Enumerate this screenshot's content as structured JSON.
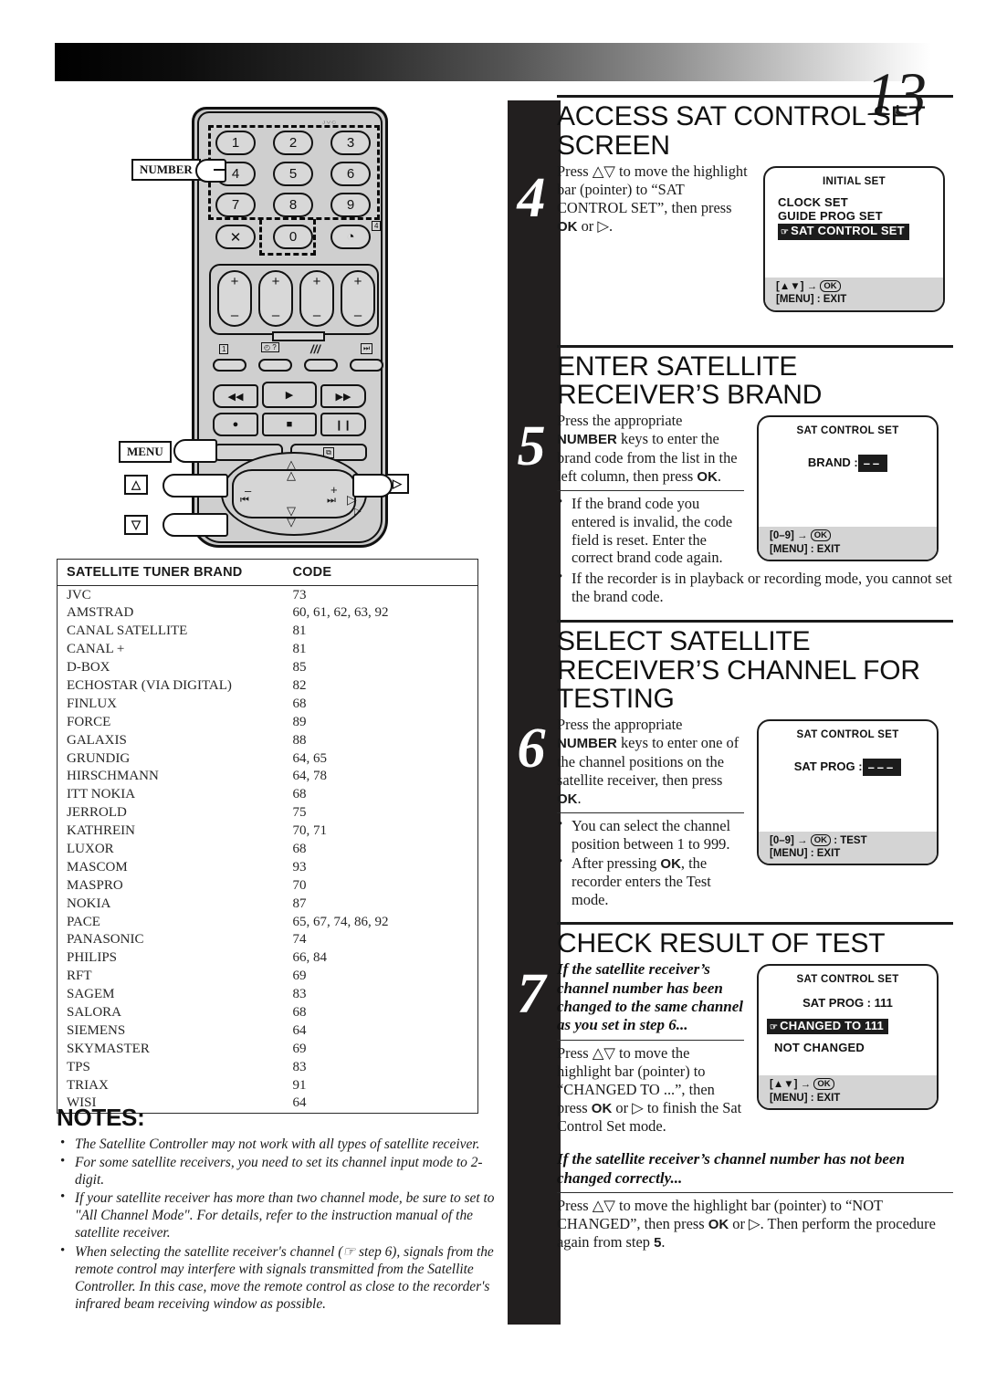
{
  "page": {
    "number": "13"
  },
  "remote": {
    "logo": "JVC",
    "number_keys": [
      "1",
      "2",
      "3",
      "4",
      "5",
      "6",
      "7",
      "8",
      "9",
      "0"
    ],
    "cancel_key": "✕",
    "timer_key": "◔",
    "callout_number": "NUMBER",
    "callout_menu": "MENU",
    "callout_up": "△",
    "callout_down": "▽",
    "callout_right": "▷",
    "plus_minus": {
      "plus": "+",
      "minus": "–"
    },
    "small_labels": [
      "1",
      "◴ ?",
      "///",
      "⏭"
    ],
    "transport_keys": [
      "◀◀",
      "▶",
      "▶▶",
      "●",
      "■",
      "❙❙"
    ],
    "jog_labels": {
      "minus": "–",
      "plus": "+",
      "rew": "⏮",
      "ff": "⏭"
    },
    "menu_side_label": "⧉"
  },
  "brand_table": {
    "headers": [
      "SATELLITE TUNER BRAND",
      "CODE"
    ],
    "rows": [
      [
        "JVC",
        "73"
      ],
      [
        "AMSTRAD",
        "60, 61, 62, 63, 92"
      ],
      [
        "CANAL SATELLITE",
        "81"
      ],
      [
        "CANAL +",
        "81"
      ],
      [
        "D-BOX",
        "85"
      ],
      [
        "ECHOSTAR (VIA DIGITAL)",
        "82"
      ],
      [
        "FINLUX",
        "68"
      ],
      [
        "FORCE",
        "89"
      ],
      [
        "GALAXIS",
        "88"
      ],
      [
        "GRUNDIG",
        "64, 65"
      ],
      [
        "HIRSCHMANN",
        "64, 78"
      ],
      [
        "ITT NOKIA",
        "68"
      ],
      [
        "JERROLD",
        "75"
      ],
      [
        "KATHREIN",
        "70, 71"
      ],
      [
        "LUXOR",
        "68"
      ],
      [
        "MASCOM",
        "93"
      ],
      [
        "MASPRO",
        "70"
      ],
      [
        "NOKIA",
        "87"
      ],
      [
        "PACE",
        "65, 67, 74, 86, 92"
      ],
      [
        "PANASONIC",
        "74"
      ],
      [
        "PHILIPS",
        "66, 84"
      ],
      [
        "RFT",
        "69"
      ],
      [
        "SAGEM",
        "83"
      ],
      [
        "SALORA",
        "68"
      ],
      [
        "SIEMENS",
        "64"
      ],
      [
        "SKYMASTER",
        "69"
      ],
      [
        "TPS",
        "83"
      ],
      [
        "TRIAX",
        "91"
      ],
      [
        "WISI",
        "64"
      ]
    ]
  },
  "notes": {
    "title": "NOTES:",
    "items": [
      "The Satellite Controller may not work with all types of satellite receiver.",
      "For some satellite receivers, you need to set its channel input mode to 2-digit.",
      "If your satellite receiver has more than two channel mode, be sure to set to \"All Channel Mode\". For details, refer to the instruction manual of the satellite receiver.",
      "When selecting the satellite receiver's channel (☞ step 6), signals from the remote control may interfere with signals transmitted from the Satellite Controller. In this case, move the remote control as close to the recorder's infrared beam receiving window as possible."
    ]
  },
  "steps": {
    "step4": {
      "number": "4",
      "heading": "ACCESS SAT CONTROL SET SCREEN",
      "body": "Press △▽ to move the highlight bar (pointer) to “SAT CONTROL SET”, then press OK or ▷.",
      "screen": {
        "title": "INITIAL SET",
        "lines": [
          "CLOCK SET",
          "GUIDE PROG SET"
        ],
        "highlighted": "SAT CONTROL SET",
        "footer_line1": "[▲▼] → OK",
        "footer_line2": "[MENU] : EXIT"
      }
    },
    "step5": {
      "number": "5",
      "heading": "ENTER SATELLITE RECEIVER’S BRAND",
      "body": "Press the appropriate NUMBER keys to enter the brand code from the list in the left column, then press OK.",
      "bullets": [
        "If the brand code you entered is invalid, the code field is reset. Enter the correct brand code again.",
        "If the recorder is in playback or recording mode, you cannot set the brand code."
      ],
      "screen": {
        "title": "SAT CONTROL SET",
        "field_label": "BRAND :",
        "field_value": "––",
        "footer_line1": "[0–9] → OK",
        "footer_line2": "[MENU] : EXIT"
      }
    },
    "step6": {
      "number": "6",
      "heading": "SELECT SATELLITE RECEIVER’S CHANNEL FOR TESTING",
      "body": "Press the appropriate NUMBER keys to enter one of the channel positions on the satellite receiver, then press OK.",
      "bullets": [
        "You can select the channel position between 1 to 999.",
        "After pressing OK, the recorder enters the Test mode."
      ],
      "screen": {
        "title": "SAT CONTROL SET",
        "field_label": "SAT PROG :",
        "field_value": "–––",
        "footer_line1": "[0–9] → OK : TEST",
        "footer_line2": "[MENU] : EXIT"
      }
    },
    "step7": {
      "number": "7",
      "heading": "CHECK RESULT OF TEST",
      "subhead1": "If the satellite receiver’s channel number has been changed to the same channel as you set in step 6...",
      "body1": "Press △▽ to move the highlight bar (pointer) to “CHANGED TO ...”, then press OK or ▷ to finish the Sat Control Set mode.",
      "subhead2": "If the satellite receiver’s channel number has not been changed correctly...",
      "body2": "Press △▽ to move the highlight bar (pointer) to “NOT CHANGED”, then press OK or ▷. Then perform the procedure again from step 5.",
      "screen": {
        "title": "SAT CONTROL SET",
        "line1": "SAT PROG : 111",
        "highlighted": "CHANGED TO 111",
        "line2": "NOT CHANGED",
        "footer_line1": "[▲▼] → OK",
        "footer_line2": "[MENU] : EXIT"
      }
    }
  }
}
